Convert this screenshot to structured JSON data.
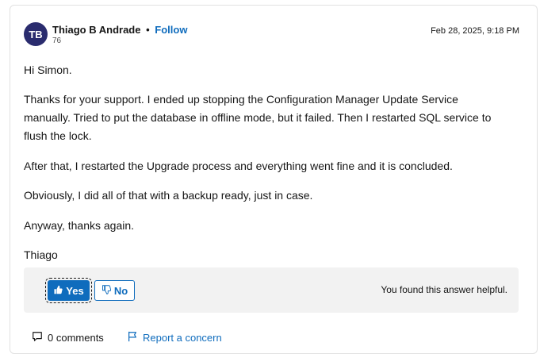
{
  "author": {
    "initials": "TB",
    "name": "Thiago B Andrade",
    "separator": "•",
    "follow_label": "Follow",
    "reputation": "76"
  },
  "post": {
    "date": "Feb 28, 2025, 9:18 PM",
    "lines": [
      "Hi Simon.",
      "Thanks for your support. I ended up stopping the Configuration Manager Update Service",
      "manually. Tried to put the database in offline mode, but it failed. Then I restarted SQL service to",
      "flush the lock.",
      "After that, I restarted the Upgrade process and everything went fine and it is concluded.",
      "Obviously, I did all of that with a backup ready, just in case.",
      "Anyway, thanks again.",
      "Thiago"
    ]
  },
  "feedback": {
    "yes_label": "Yes",
    "no_label": "No",
    "message": "You found this answer helpful."
  },
  "footer": {
    "comments_label": "0 comments",
    "report_label": "Report a concern"
  },
  "colors": {
    "accent": "#0f6cbd",
    "avatar_bg": "#2a2c6e",
    "feedback_bg": "#f2f2f2"
  },
  "icons": [
    "thumbs-up-icon",
    "thumbs-down-icon",
    "comment-icon",
    "flag-icon"
  ]
}
